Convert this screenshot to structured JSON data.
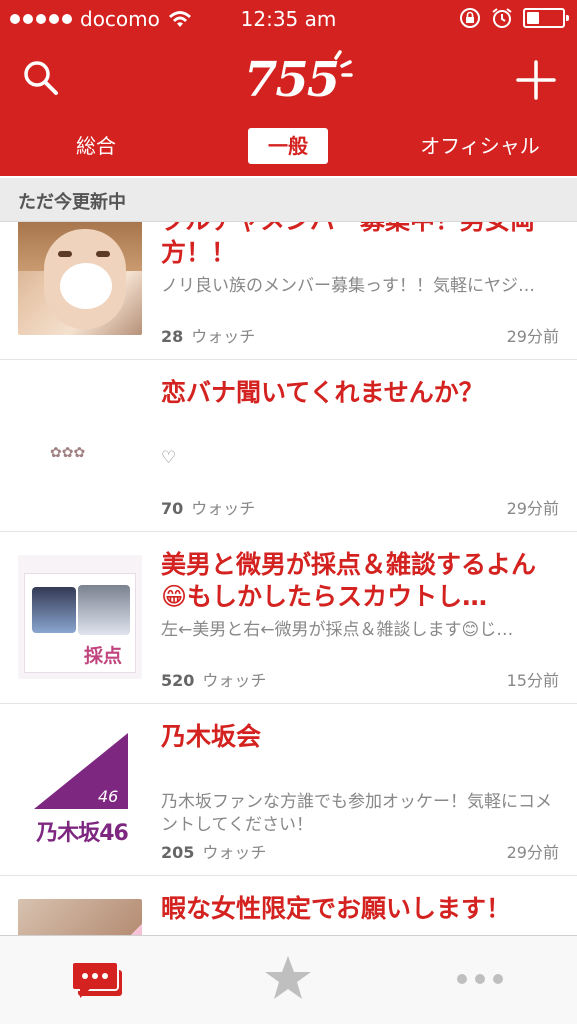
{
  "status_bar": {
    "carrier": "docomo",
    "time": "12:35 am",
    "signal_dots": 5,
    "battery_level": 0.35
  },
  "header": {
    "logo_text": "755",
    "search_icon": "search-icon",
    "add_icon": "plus-icon",
    "tabs": [
      {
        "label": "総合",
        "selected": false
      },
      {
        "label": "一般",
        "selected": true
      },
      {
        "label": "オフィシャル",
        "selected": false
      }
    ]
  },
  "section": {
    "title": "ただ今更新中"
  },
  "items": [
    {
      "title": "クルチャメンバー募集中！男女両方！！",
      "description": "ノリ良い族のメンバー募集っす！！気軽にヤジ…",
      "watch_count": "28",
      "watch_label": "ウォッチ",
      "time": "29分前"
    },
    {
      "title": "恋バナ聞いてくれませんか？",
      "description": "♡",
      "watch_count": "70",
      "watch_label": "ウォッチ",
      "time": "29分前",
      "thumb_text": "✿✿✿"
    },
    {
      "title": "美男と微男が採点＆雑談するよん😁もしかしたらスカウトし…",
      "description": "左←美男と右←微男が採点＆雑談します😊じ…",
      "watch_count": "520",
      "watch_label": "ウォッチ",
      "time": "15分前",
      "thumb_text": "採点"
    },
    {
      "title": "乃木坂会",
      "description": "乃木坂ファンな方誰でも参加オッケー！気軽にコメントしてください！",
      "watch_count": "205",
      "watch_label": "ウォッチ",
      "time": "29分前",
      "thumb_text": "乃木坂46",
      "thumb_small": "46"
    },
    {
      "title": "暇な女性限定でお願いします！",
      "description": "",
      "watch_count": "",
      "watch_label": "",
      "time": ""
    }
  ],
  "tab_bar": {
    "items": [
      {
        "icon": "chat-icon",
        "active": true
      },
      {
        "icon": "star-icon",
        "active": false
      },
      {
        "icon": "more-icon",
        "active": false
      }
    ]
  },
  "colors": {
    "brand_red": "#d3221f",
    "section_bg": "#ebebeb",
    "tabbar_inactive": "#bfbfbf",
    "nogi_purple": "#7e2781"
  }
}
